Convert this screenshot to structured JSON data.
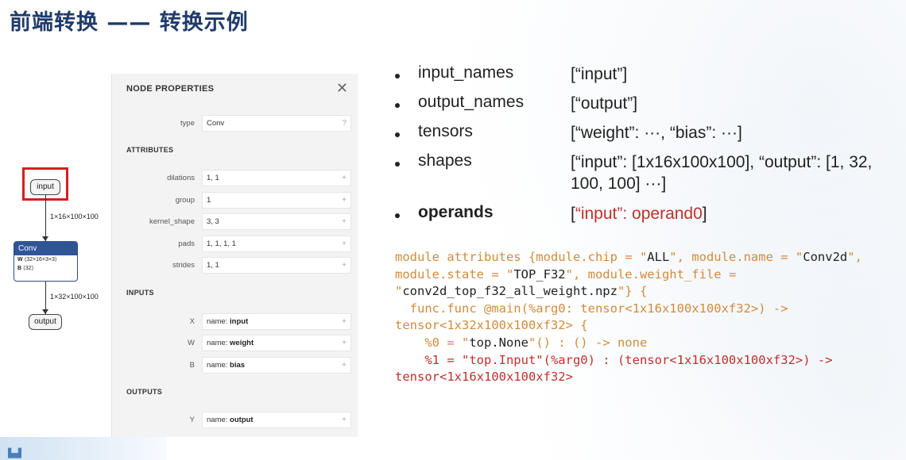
{
  "title": "前端转换 —— 转换示例",
  "graph": {
    "input_label": "input",
    "edge1": "1×16×100×100",
    "conv_title": "Conv",
    "conv_w_key": "W",
    "conv_w_val": "⟨32×16×3×3⟩",
    "conv_b_key": "B",
    "conv_b_val": "⟨32⟩",
    "edge2": "1×32×100×100",
    "output_label": "output"
  },
  "properties": {
    "header": "NODE PROPERTIES",
    "close": "✕",
    "type_label": "type",
    "type_value": "Conv",
    "type_hint": "?",
    "attributes_title": "ATTRIBUTES",
    "attributes": [
      {
        "label": "dilations",
        "value": "1, 1"
      },
      {
        "label": "group",
        "value": "1"
      },
      {
        "label": "kernel_shape",
        "value": "3, 3"
      },
      {
        "label": "pads",
        "value": "1, 1, 1, 1"
      },
      {
        "label": "strides",
        "value": "1, 1"
      }
    ],
    "inputs_title": "INPUTS",
    "inputs": [
      {
        "label": "X",
        "prefix": "name: ",
        "name": "input"
      },
      {
        "label": "W",
        "prefix": "name: ",
        "name": "weight"
      },
      {
        "label": "B",
        "prefix": "name: ",
        "name": "bias"
      }
    ],
    "outputs_title": "OUTPUTS",
    "outputs": [
      {
        "label": "Y",
        "prefix": "name: ",
        "name": "output"
      }
    ],
    "plus": "+"
  },
  "bullets": [
    {
      "key": "input_names",
      "value": "[“input”]"
    },
    {
      "key": "output_names",
      "value": "[“output”]"
    },
    {
      "key": "tensors",
      "value": "[“weight”: ···, “bias”: ···]"
    },
    {
      "key": "shapes",
      "value": "[“input”: [1x16x100x100], “output”: [1, 32, 100, 100] ···]"
    },
    {
      "key": "operands",
      "value_open": "[",
      "value_red": "“input”: operand0",
      "value_close": "]"
    }
  ],
  "code": {
    "l1a": "module attributes {module.chip = \"",
    "l1b": "ALL",
    "l1c": "\", module.name = \"",
    "l1d": "Conv2d",
    "l1e": "\",",
    "l2a": "module.state = \"",
    "l2b": "TOP_F32",
    "l2c": "\", module.weight_file =",
    "l3a": "\"",
    "l3b": "conv2d_top_f32_all_weight.npz",
    "l3c": "\"} {",
    "l4": "  func.func @main(%arg0: tensor<1x16x100x100xf32>) ->",
    "l5": "tensor<1x32x100x100xf32> {",
    "l6a": "    %0 = \"",
    "l6b": "top.None",
    "l6c": "\"() : () -> none",
    "l7": "    %1 = \"top.Input\"(%arg0) : (tensor<1x16x100x100xf32>) ->",
    "l8": "tensor<1x16x100x100xf32>"
  }
}
